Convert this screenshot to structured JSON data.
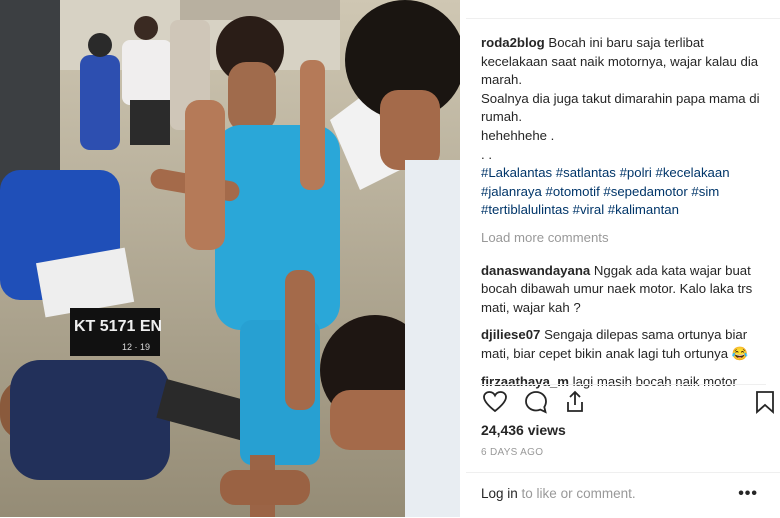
{
  "post": {
    "caption_user": "roda2blog",
    "caption_lines": [
      "Bocah ini baru saja terlibat kecelakaan saat naik motornya, wajar kalau dia marah.",
      "Soalnya dia juga takut dimarahin papa mama di rumah.",
      "hehehhehe .",
      ". ."
    ],
    "hashtags": "#Lakalantas #satlantas #polri #kecelakaan #jalanraya #otomotif #sepedamotor #sim #tertiblalulintas #viral #kalimantan",
    "load_more": "Load more comments",
    "comments": [
      {
        "user": "danaswandayana",
        "text": "Nggak ada kata wajar buat bocah dibawah umur naek motor. Kalo laka trs mati, wajar kah ?"
      },
      {
        "user": "djiliese07",
        "text": "Sengaja dilepas sama ortunya biar mati, biar cepet bikin anak lagi tuh ortunya 😂"
      },
      {
        "user": "firzaathaya_m",
        "text": "lagi masih bocah naik motor"
      }
    ],
    "views": "24,436 views",
    "date": "6 DAYS AGO",
    "login_link": "Log in",
    "login_rest": " to like or comment.",
    "more": "•••"
  },
  "icons": {
    "like": "heart-icon",
    "comment": "comment-bubble-icon",
    "share": "share-icon",
    "save": "bookmark-icon"
  },
  "video": {
    "plate_text": "KT 5171 EN",
    "plate_sub": "12 · 19"
  }
}
